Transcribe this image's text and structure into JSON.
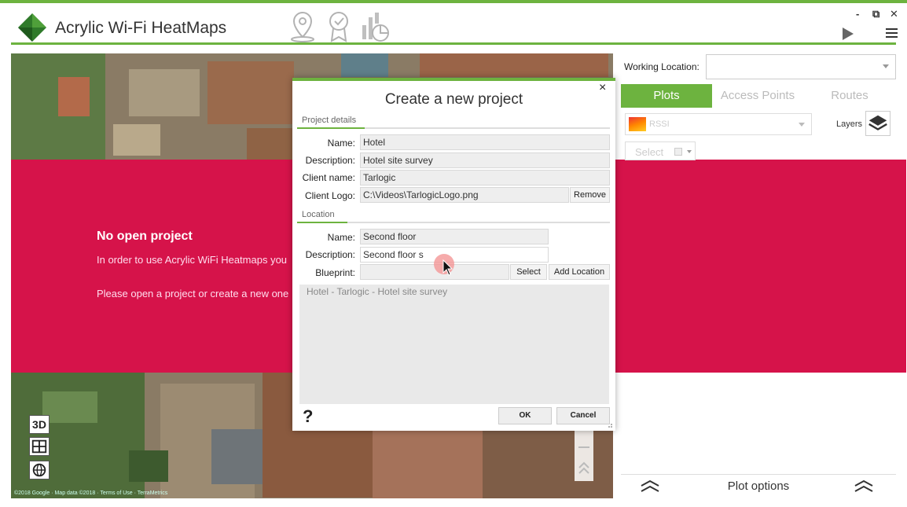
{
  "app": {
    "title": "Acrylic Wi-Fi HeatMaps",
    "window_controls": {
      "minimize": "-",
      "restore": "⧉",
      "close": "✕"
    },
    "toolbar_icons": [
      "location-pin-icon",
      "certificate-icon",
      "report-chart-icon"
    ]
  },
  "main": {
    "no_project_title": "No open project",
    "message_line1": "In order to use Acrylic WiFi Heatmaps you",
    "message_line2": "Please open a project or create a new one",
    "map_attribution": "©2018 Google · Map data ©2018 · Terms of Use · TerraMetrics",
    "map_tools": [
      "3D"
    ]
  },
  "right_panel": {
    "working_location_label": "Working Location:",
    "working_location_value": "",
    "tabs": [
      {
        "label": "Plots",
        "active": true
      },
      {
        "label": "Access Points",
        "active": false
      },
      {
        "label": "Routes",
        "active": false
      }
    ],
    "plot_type": "RSSI",
    "layers_label": "Layers",
    "select_label": "Select",
    "plot_options_label": "Plot options"
  },
  "dialog": {
    "title": "Create a new project",
    "close": "×",
    "project_details_label": "Project details",
    "location_label": "Location",
    "fields": {
      "name_label": "Name:",
      "name_value": "Hotel",
      "description_label": "Description:",
      "description_value": "Hotel site survey",
      "client_name_label": "Client name:",
      "client_name_value": "Tarlogic",
      "client_logo_label": "Client Logo:",
      "client_logo_value": "C:\\Videos\\TarlogicLogo.png",
      "remove_button": "Remove"
    },
    "location": {
      "name_label": "Name:",
      "name_value": "Second floor",
      "description_label": "Description:",
      "description_value": "Second floor s",
      "blueprint_label": "Blueprint:",
      "blueprint_value": "",
      "select_button": "Select",
      "add_location_button": "Add Location"
    },
    "list_items": [
      "Hotel - Tarlogic - Hotel site survey"
    ],
    "help": "?",
    "ok_button": "OK",
    "cancel_button": "Cancel"
  },
  "colors": {
    "accent_green": "#6db33f",
    "alert_red": "#d6134a"
  }
}
